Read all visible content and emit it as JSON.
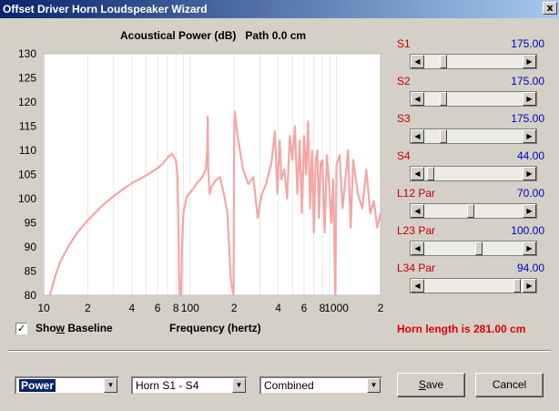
{
  "window": {
    "title": "Offset Driver Horn Loudspeaker Wizard",
    "close_glyph": "x"
  },
  "chart_title": "Acoustical Power (dB)   Path 0.0 cm",
  "chart_data": {
    "type": "line",
    "title": "Acoustical Power (dB)   Path 0.0 cm",
    "xlabel": "Frequency (hertz)",
    "ylabel": "",
    "xscale": "log",
    "xlim": [
      10,
      2000
    ],
    "ylim": [
      80,
      130
    ],
    "y_ticks": [
      "130",
      "125",
      "120",
      "115",
      "110",
      "105",
      "100",
      "95",
      "90",
      "85",
      "80"
    ],
    "x_ticks": [
      "10",
      "2",
      "4",
      "6",
      "8",
      "100",
      "2",
      "4",
      "6",
      "8",
      "1000",
      "2"
    ],
    "series": [
      {
        "color": "#f4a6a6",
        "x": [
          11,
          12,
          13,
          15,
          17,
          20,
          25,
          30,
          35,
          40,
          50,
          60,
          65,
          70,
          75,
          80,
          82,
          83,
          84,
          85,
          86,
          87,
          88,
          90,
          95,
          100,
          110,
          120,
          128,
          131,
          132,
          133,
          136,
          140,
          150,
          160,
          170,
          180,
          190,
          198,
          200,
          202,
          210,
          230,
          250,
          270,
          285,
          290,
          300,
          310,
          330,
          360,
          380,
          395,
          400,
          410,
          420,
          440,
          460,
          480,
          500,
          520,
          540,
          560,
          580,
          600,
          620,
          640,
          660,
          680,
          700,
          720,
          740,
          760,
          780,
          800,
          830,
          860,
          890,
          920,
          950,
          980,
          1000,
          1050,
          1100,
          1150,
          1200,
          1250,
          1300,
          1400,
          1500,
          1600,
          1700,
          1800,
          1900,
          2000
        ],
        "y": [
          80,
          84,
          87,
          90.5,
          93,
          95.5,
          98.5,
          100.5,
          102,
          103.2,
          104.8,
          106.3,
          107.2,
          108.5,
          109.3,
          108,
          105,
          97,
          85,
          80,
          80,
          80,
          90,
          97,
          100.5,
          101.2,
          103,
          104.3,
          106,
          110,
          117,
          106,
          101,
          102.5,
          103.8,
          104.5,
          101,
          97,
          83,
          80,
          113,
          118,
          113.5,
          106,
          103,
          104.5,
          98,
          96,
          99,
          101,
          103,
          107.5,
          114,
          101,
          106,
          112,
          104,
          106,
          100,
          113,
          108,
          115,
          101,
          112,
          97,
          113,
          105,
          116,
          98,
          110,
          93,
          108,
          110,
          96,
          107.5,
          108,
          93,
          109,
          103,
          95,
          104,
          80,
          107,
          109,
          98,
          104,
          110,
          94,
          108,
          101,
          98,
          106,
          97,
          99.5,
          94,
          97
        ]
      }
    ]
  },
  "sliders": [
    {
      "label": "S1",
      "value": "175.00",
      "position": 0.17
    },
    {
      "label": "S2",
      "value": "175.00",
      "position": 0.17
    },
    {
      "label": "S3",
      "value": "175.00",
      "position": 0.17
    },
    {
      "label": "S4",
      "value": "44.00",
      "position": 0.03
    },
    {
      "label": "L12  Par",
      "value": "70.00",
      "position": 0.47
    },
    {
      "label": "L23  Par",
      "value": "100.00",
      "position": 0.56
    },
    {
      "label": "L34  Par",
      "value": "94.00",
      "position": 0.98
    }
  ],
  "show_baseline": {
    "checked_glyph": "✓",
    "label_pre": "Sho",
    "label_accel": "w",
    "label_post": " Baseline"
  },
  "xaxis_title": "Frequency (hertz)",
  "horn_length": "Horn length is 281.00 cm",
  "combos": [
    {
      "value": "Power"
    },
    {
      "value": "Horn S1 - S4"
    },
    {
      "value": "Combined"
    }
  ],
  "buttons": {
    "save_accel": "S",
    "save_rest": "ave",
    "cancel": "Cancel"
  },
  "arrows": {
    "left": "◀",
    "right": "▶",
    "down": "▼"
  }
}
